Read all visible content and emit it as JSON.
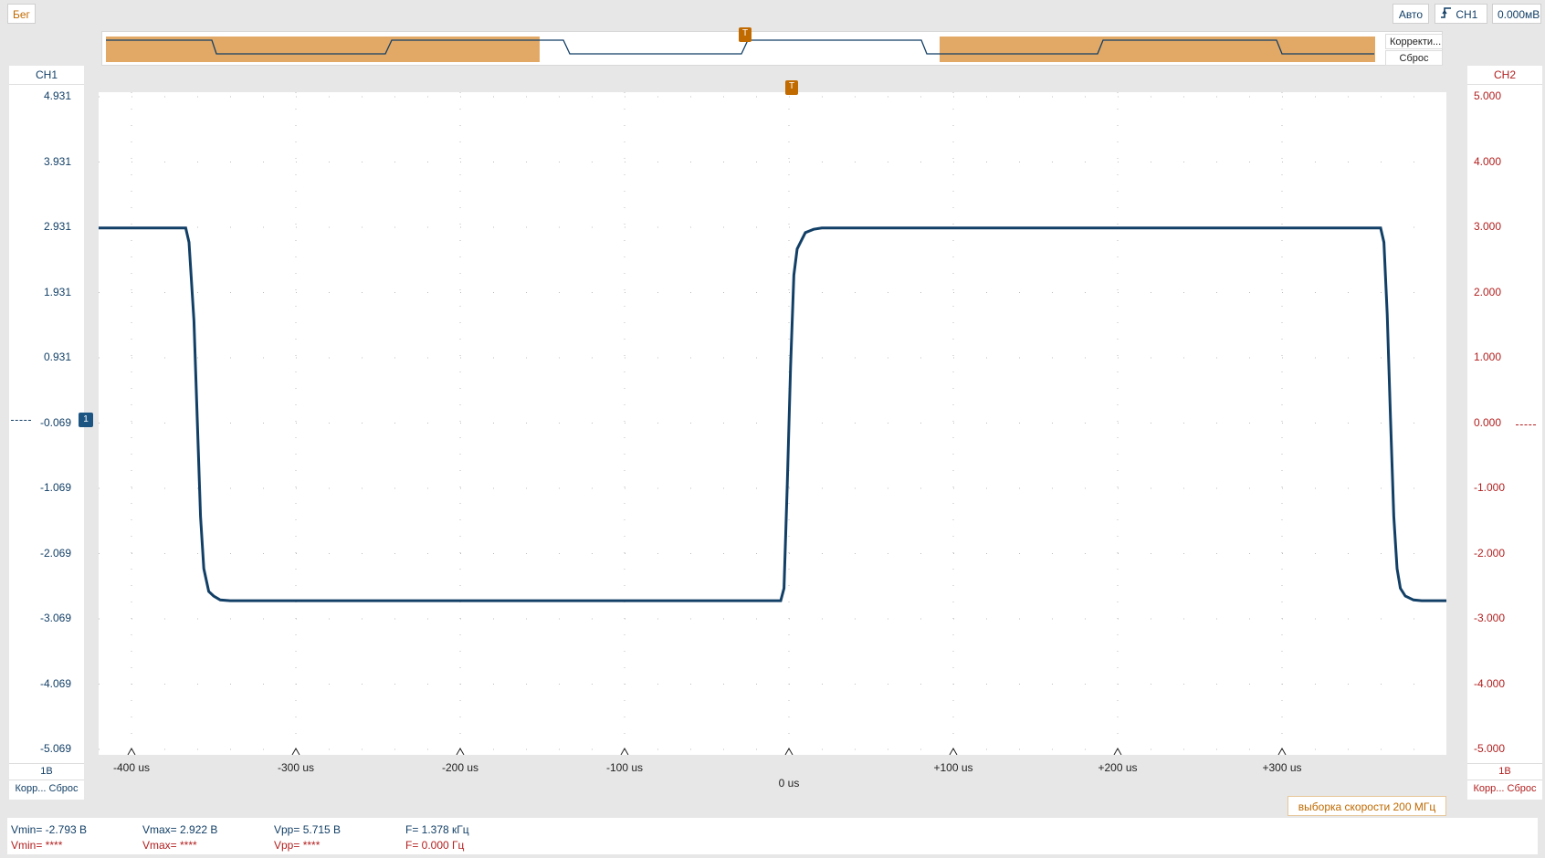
{
  "toolbar": {
    "run_label": "Бег",
    "auto_label": "Авто",
    "trigger_channel": "CH1",
    "trigger_level": "0.000мВ"
  },
  "overview": {
    "correct_label": "Корректи...",
    "reset_label": "Сброс",
    "trigger_marker": "T"
  },
  "channels": {
    "ch1": {
      "name": "CH1",
      "scale": "1В",
      "corr_reset": "Корр... Сброс",
      "color": "#123f66",
      "ground_marker": "1"
    },
    "ch2": {
      "name": "CH2",
      "scale": "1В",
      "corr_reset": "Корр... Сброс",
      "color": "#b21e1e"
    }
  },
  "sample_rate": "выборка скорости 200 МГц",
  "measurements": {
    "ch1": {
      "vmin": "Vmin= -2.793 В",
      "vmax": "Vmax= 2.922 В",
      "vpp": "Vpp= 5.715 В",
      "freq": "F= 1.378 кГц"
    },
    "ch2": {
      "vmin": "Vmin= ****",
      "vmax": "Vmax= ****",
      "vpp": "Vpp= ****",
      "freq": "F= 0.000 Гц"
    }
  },
  "chart_data": {
    "type": "line",
    "title": "",
    "xlabel": "",
    "ylabel": "",
    "xlim": [
      -420,
      400
    ],
    "ylim_ch1": [
      -5.069,
      4.931
    ],
    "ylim_ch2": [
      -5.0,
      5.0
    ],
    "x_tick_labels": [
      "-400 us",
      "-300 us",
      "-200 us",
      "-100 us",
      "0 us",
      "+100 us",
      "+200 us",
      "+300 us"
    ],
    "x_ticks": [
      -400,
      -300,
      -200,
      -100,
      0,
      100,
      200,
      300
    ],
    "y_tick_labels_ch1": [
      "4.931",
      "3.931",
      "2.931",
      "1.931",
      "0.931",
      "-0.069",
      "-1.069",
      "-2.069",
      "-3.069",
      "-4.069",
      "-5.069"
    ],
    "y_tick_labels_ch2": [
      "5.000",
      "4.000",
      "3.000",
      "2.000",
      "1.000",
      "0.000",
      "-1.000",
      "-2.000",
      "-3.000",
      "-4.000",
      "-5.000"
    ],
    "grid": true,
    "series": [
      {
        "name": "CH1",
        "x": [
          -420,
          -367,
          -365,
          -362,
          -360,
          -358,
          -356,
          -353,
          -350,
          -346,
          -340,
          -10,
          -5,
          -3,
          -1,
          1,
          3,
          5,
          8,
          10,
          15,
          20,
          360,
          362,
          364,
          366,
          368,
          370,
          372,
          375,
          380,
          385,
          400
        ],
        "y": [
          2.92,
          2.92,
          2.7,
          1.5,
          0.0,
          -1.5,
          -2.3,
          -2.65,
          -2.72,
          -2.78,
          -2.79,
          -2.79,
          -2.79,
          -2.6,
          -1.0,
          0.8,
          2.2,
          2.6,
          2.75,
          2.85,
          2.9,
          2.92,
          2.92,
          2.7,
          1.6,
          0.0,
          -1.5,
          -2.3,
          -2.6,
          -2.72,
          -2.78,
          -2.79,
          -2.79
        ]
      }
    ]
  }
}
